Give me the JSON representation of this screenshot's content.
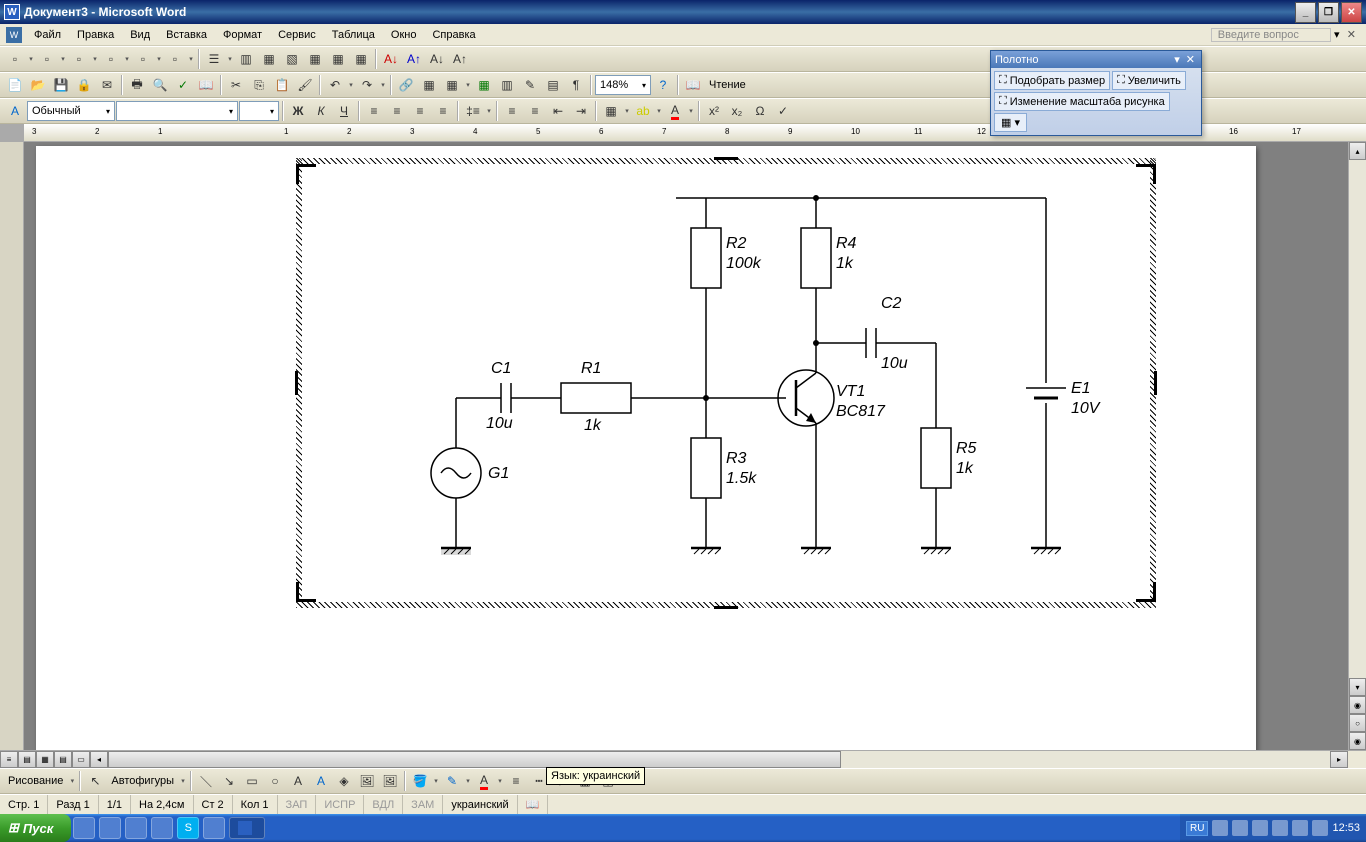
{
  "title": "Документ3 - Microsoft Word",
  "menu": {
    "file": "Файл",
    "edit": "Правка",
    "view": "Вид",
    "insert": "Вставка",
    "format": "Формат",
    "tools": "Сервис",
    "table": "Таблица",
    "window": "Окно",
    "help": "Справка",
    "question": "Введите вопрос"
  },
  "formatting": {
    "style": "Обычный",
    "zoom": "148%",
    "reading": "Чтение"
  },
  "float_toolbar": {
    "title": "Полотно",
    "fit": "Подобрать размер",
    "enlarge": "Увеличить",
    "scale": "Изменение масштаба рисунка"
  },
  "circuit": {
    "G1": "G1",
    "C1": {
      "name": "C1",
      "value": "10u"
    },
    "R1": {
      "name": "R1",
      "value": "1k"
    },
    "R2": {
      "name": "R2",
      "value": "100k"
    },
    "R3": {
      "name": "R3",
      "value": "1.5k"
    },
    "R4": {
      "name": "R4",
      "value": "1k"
    },
    "R5": {
      "name": "R5",
      "value": "1k"
    },
    "C2": {
      "name": "C2",
      "value": "10u"
    },
    "VT1": {
      "name": "VT1",
      "value": "BC817"
    },
    "E1": {
      "name": "E1",
      "value": "10V"
    }
  },
  "drawing": {
    "button": "Рисование",
    "autoshapes": "Автофигуры",
    "tooltip": "Язык: украинский"
  },
  "status": {
    "page": "Стр. 1",
    "section": "Разд 1",
    "pages": "1/1",
    "at": "На 2,4см",
    "line": "Ст 2",
    "col": "Кол 1",
    "zap": "ЗАП",
    "ispr": "ИСПР",
    "vdl": "ВДЛ",
    "zam": "ЗАМ",
    "language": "украинский"
  },
  "taskbar": {
    "start": "Пуск",
    "task1": "",
    "lang": "RU",
    "time": "12:53"
  }
}
